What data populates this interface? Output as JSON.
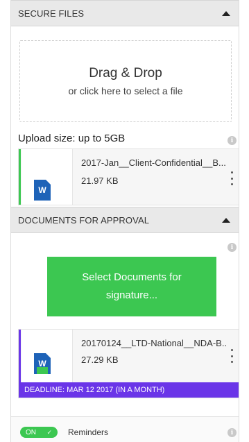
{
  "secure_files": {
    "header": "SECURE FILES",
    "dropzone": {
      "title": "Drag & Drop",
      "subtitle": "or click here to select a file"
    },
    "upload_size": "Upload size: up to 5GB",
    "file": {
      "name": "2017-Jan__Client-Confidential__B...",
      "size": "21.97 KB",
      "icon_letter": "W",
      "accent_color": "#3cc751"
    }
  },
  "documents_for_approval": {
    "header": "DOCUMENTS FOR APPROVAL",
    "select_button": "Select Documents for signature...",
    "file": {
      "name": "20170124__LTD-National__NDA-B..",
      "size": "27.29 KB",
      "icon_letter": "W",
      "accent_color": "#6a35e8",
      "deadline": "DEADLINE: MAR 12 2017 (IN A MONTH)"
    }
  },
  "footer": {
    "toggle_label": "ON",
    "toggle_state": true,
    "reminders_label": "Reminders"
  },
  "colors": {
    "green": "#3cc751",
    "purple": "#6a35e8",
    "word_blue": "#1e63b8"
  }
}
